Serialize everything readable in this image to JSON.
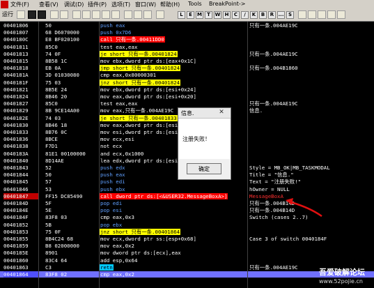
{
  "menubar": {
    "items": [
      "文件(F)",
      "查看(V)",
      "调试(D)",
      "插件(P)",
      "选项(T)",
      "窗口(W)",
      "帮助(H)",
      "Tools",
      "BreakPoint->"
    ]
  },
  "toolbar": {
    "status": "运行",
    "letters": [
      "L",
      "E",
      "M",
      "T",
      "W",
      "H",
      "C",
      "/",
      "K",
      "B",
      "R",
      "...",
      "S"
    ]
  },
  "code": {
    "rows": [
      {
        "addr": "00401806",
        "hex": "50",
        "asm": "push eax",
        "kind": "push",
        "comment": "只有一条.004AE19C"
      },
      {
        "addr": "00401807",
        "hex": "68 D6070000",
        "asm": "push 0x7D6",
        "kind": "push",
        "comment": ""
      },
      {
        "addr": "0040180C",
        "hex": "E8 BF020100",
        "asm": "call 只有一条.00411DD0",
        "kind": "call",
        "comment": ""
      },
      {
        "addr": "00401811",
        "hex": "85C0",
        "asm": "test eax,eax",
        "kind": "",
        "comment": ""
      },
      {
        "addr": "00401813",
        "hex": "74 0F",
        "asm": "je short 只有一条.00401824",
        "kind": "jcc",
        "comment": "只有一条.004AE19C"
      },
      {
        "addr": "00401815",
        "hex": "8B58 1C",
        "asm": "mov ebx,dword ptr ds:[eax+0x1C]",
        "kind": "",
        "comment": ""
      },
      {
        "addr": "00401818",
        "hex": "EB 0A",
        "asm": "jmp short 只有一条.00401824",
        "kind": "jcc",
        "comment": "只有一条.004B1860"
      },
      {
        "addr": "0040181A",
        "hex": "3D 01030080",
        "asm": "cmp eax,0x80000301",
        "kind": "",
        "comment": ""
      },
      {
        "addr": "0040181F",
        "hex": "75 03",
        "asm": "jnz short 只有一条.00401824",
        "kind": "jcc",
        "comment": ""
      },
      {
        "addr": "00401821",
        "hex": "8B5E 24",
        "asm": "mov ebx,dword ptr ds:[esi+0x24]",
        "kind": "",
        "comment": ""
      },
      {
        "addr": "00401824",
        "hex": "8B46 20",
        "asm": "mov eax,dword ptr ds:[esi+0x20]",
        "kind": "",
        "comment": ""
      },
      {
        "addr": "00401827",
        "hex": "85C0",
        "asm": "test eax,eax",
        "kind": "",
        "comment": "只有一条.004AE19C"
      },
      {
        "addr": "00401829",
        "hex": "8B 9CE14A00",
        "asm": "mov eax,只有一条.004AE19C",
        "kind": "",
        "comment": "信息."
      },
      {
        "addr": "0040182E",
        "hex": "74 03",
        "asm": "je short 只有一条.00401833",
        "kind": "jcc",
        "comment": ""
      },
      {
        "addr": "00401830",
        "hex": "8B46 18",
        "asm": "mov eax,dword ptr ds:[esi+0x18]",
        "kind": "",
        "comment": ""
      },
      {
        "addr": "00401833",
        "hex": "8B76 0C",
        "asm": "mov esi,dword ptr ds:[esi+0xC]",
        "kind": "",
        "comment": ""
      },
      {
        "addr": "00401836",
        "hex": "8BCE",
        "asm": "mov ecx,esi",
        "kind": "",
        "comment": ""
      },
      {
        "addr": "00401838",
        "hex": "F7D1",
        "asm": "not ecx",
        "kind": "",
        "comment": ""
      },
      {
        "addr": "0040183A",
        "hex": "81E1 00100000",
        "asm": "and ecx,0x1000",
        "kind": "",
        "comment": ""
      },
      {
        "addr": "00401840",
        "hex": "8D14AE",
        "asm": "lea edx,dword ptr ds:[esi+ebp*4]",
        "kind": "",
        "comment": ""
      },
      {
        "addr": "00401843",
        "hex": "52",
        "asm": "push edx",
        "kind": "push",
        "comment": "Style = MB_OK|MB_TASKMODAL"
      },
      {
        "addr": "00401844",
        "hex": "50",
        "asm": "push eax",
        "kind": "push",
        "comment": "Title = \"信息.\""
      },
      {
        "addr": "00401845",
        "hex": "57",
        "asm": "push edi",
        "kind": "push",
        "comment": "Text = \"注册失败!\""
      },
      {
        "addr": "00401846",
        "hex": "53",
        "asm": "push ebx",
        "kind": "push",
        "comment": "hOwner = NULL"
      },
      {
        "addr": "00401847",
        "hex": "FF15 DC85490",
        "asm": "call dword ptr ds:[<&USER32.MessageBoxA>]",
        "kind": "call",
        "comment": "MessageBoxA",
        "bp": true
      },
      {
        "addr": "0040184D",
        "hex": "5F",
        "asm": "pop edi",
        "kind": "push",
        "comment": "只有一条.004B14D"
      },
      {
        "addr": "0040184E",
        "hex": "5E",
        "asm": "pop esi",
        "kind": "push",
        "comment": "只有一条.004B14D"
      },
      {
        "addr": "0040184F",
        "hex": "83F8 03",
        "asm": "cmp eax,0x3",
        "kind": "",
        "comment": "Switch (cases 2..7)"
      },
      {
        "addr": "00401852",
        "hex": "5B",
        "asm": "pop ebx",
        "kind": "push",
        "comment": ""
      },
      {
        "addr": "00401853",
        "hex": "75 0F",
        "asm": "jnz short 只有一条.00401864",
        "kind": "jcc",
        "comment": ""
      },
      {
        "addr": "00401855",
        "hex": "8B4C24 68",
        "asm": "mov ecx,dword ptr ss:[esp+0x68]",
        "kind": "",
        "comment": "Case 3 of switch 0040184F"
      },
      {
        "addr": "00401859",
        "hex": "B8 02000000",
        "asm": "mov eax,0x2",
        "kind": "",
        "comment": ""
      },
      {
        "addr": "0040185E",
        "hex": "8901",
        "asm": "mov dword ptr ds:[ecx],eax",
        "kind": "",
        "comment": ""
      },
      {
        "addr": "00401860",
        "hex": "83C4 64",
        "asm": "add esp,0x64",
        "kind": "",
        "comment": ""
      },
      {
        "addr": "00401863",
        "hex": "C3",
        "asm": "retn",
        "kind": "ret",
        "comment": "只有一条.004AE19C"
      },
      {
        "addr": "00401864",
        "hex": "83F8 02",
        "asm": "cmp eax,0x2",
        "kind": "",
        "comment": "",
        "cur": true
      }
    ]
  },
  "dialog": {
    "title": "信息.",
    "close": "✕",
    "message": "注册失败！",
    "ok_label": "确定"
  },
  "watermark": {
    "line1": "吾爱破解论坛",
    "line2": "www.52pojie.cn"
  },
  "colors": {
    "background": "#000000",
    "breakpoint": "#c00000",
    "call": "#ff0000",
    "jump": "#ffff00",
    "annotation_arrow": "#e01010"
  }
}
